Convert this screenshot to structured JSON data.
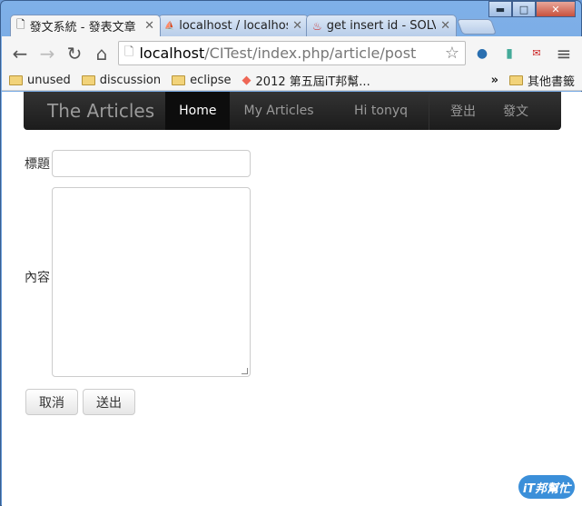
{
  "window": {
    "minimize": "▬",
    "maximize": "□",
    "close": "✕"
  },
  "tabs": [
    {
      "title": "發文系統 - 發表文章",
      "icon": "page-icon"
    },
    {
      "title": "localhost / localhost",
      "icon": "pma-icon"
    },
    {
      "title": "get insert id - SOLVE",
      "icon": "flame-icon"
    }
  ],
  "toolbar": {
    "back": "←",
    "forward": "→",
    "reload": "↻",
    "home": "⌂",
    "url_host": "localhost",
    "url_path": "/CITest/index.php/article/post",
    "star": "☆",
    "menu": "≡"
  },
  "bookmarks": [
    {
      "label": "unused"
    },
    {
      "label": "discussion"
    },
    {
      "label": "eclipse"
    },
    {
      "label": "2012 第五屆iT邦幫..."
    }
  ],
  "bookmarks_more": "»",
  "other_bookmarks": "其他書籤",
  "site": {
    "brand": "The Articles",
    "nav_home": "Home",
    "nav_my_articles": "My Articles",
    "greeting": "Hi tonyq",
    "logout": "登出",
    "post": "發文"
  },
  "form": {
    "title_label": "標題",
    "content_label": "內容",
    "title_value": "",
    "content_value": "",
    "cancel": "取消",
    "submit": "送出"
  },
  "watermark": "iT邦幫忙"
}
